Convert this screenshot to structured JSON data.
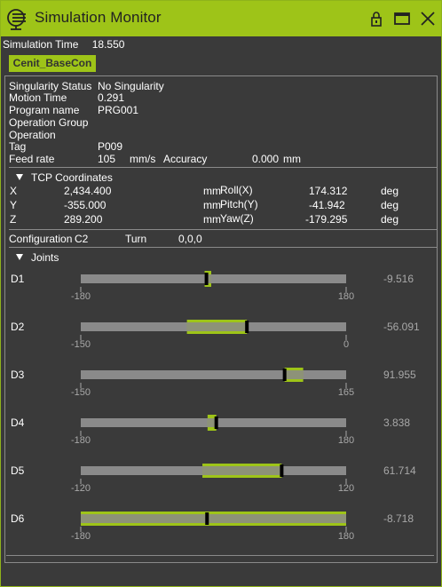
{
  "window": {
    "title": "Simulation Monitor"
  },
  "sim": {
    "time_label": "Simulation Time",
    "time_value": "18.550"
  },
  "tab": {
    "label": "Cenit_BaseCon"
  },
  "status": {
    "rows": [
      {
        "label": "Singularity Status",
        "value": "No Singularity"
      },
      {
        "label": "Motion Time",
        "value": "0.291"
      },
      {
        "label": "Program name",
        "value": "PRG001"
      },
      {
        "label": "Operation Group",
        "value": ""
      },
      {
        "label": "Operation",
        "value": ""
      },
      {
        "label": "Tag",
        "value": "P009"
      }
    ],
    "feed_label": "Feed rate",
    "feed_value": "105",
    "feed_unit": "mm/s",
    "accuracy_label": "Accuracy",
    "accuracy_value": "0.000",
    "accuracy_unit": "mm"
  },
  "tcp": {
    "header": "TCP Coordinates",
    "rows": [
      {
        "axis": "X",
        "value": "2,434.400",
        "unit": "mm",
        "rot_label": "Roll(X)",
        "rot_value": "174.312",
        "rot_unit": "deg"
      },
      {
        "axis": "Y",
        "value": "-355.000",
        "unit": "mm",
        "rot_label": "Pitch(Y)",
        "rot_value": "-41.942",
        "rot_unit": "deg"
      },
      {
        "axis": "Z",
        "value": "289.200",
        "unit": "mm",
        "rot_label": "Yaw(Z)",
        "rot_value": "-179.295",
        "rot_unit": "deg"
      }
    ]
  },
  "config": {
    "label": "Configuration",
    "value": "C2",
    "turn_label": "Turn",
    "turn_value": "0,0,0"
  },
  "joints": {
    "header": "Joints",
    "items": [
      {
        "name": "D1",
        "min": -180,
        "max": 180,
        "min_label": "-180",
        "max_label": "180",
        "value": -9.516,
        "value_label": "-9.516",
        "hl_from": -12,
        "hl_to": -3,
        "band": "narrow"
      },
      {
        "name": "D2",
        "min": -150,
        "max": 0,
        "min_label": "-150",
        "max_label": "0",
        "value": -56.091,
        "value_label": "-56.091",
        "hl_from": -90,
        "hl_to": -56.091,
        "band": "wide"
      },
      {
        "name": "D3",
        "min": -150,
        "max": 165,
        "min_label": "-150",
        "max_label": "165",
        "value": 91.955,
        "value_label": "91.955",
        "hl_from": 91.955,
        "hl_to": 114,
        "band": "wide"
      },
      {
        "name": "D4",
        "min": -180,
        "max": 180,
        "min_label": "-180",
        "max_label": "180",
        "value": 3.838,
        "value_label": "3.838",
        "hl_from": -8,
        "hl_to": 3.838,
        "band": "narrow"
      },
      {
        "name": "D5",
        "min": -120,
        "max": 120,
        "min_label": "-120",
        "max_label": "120",
        "value": 61.714,
        "value_label": "61.714",
        "hl_from": -10,
        "hl_to": 61.714,
        "band": "wide"
      },
      {
        "name": "D6",
        "min": -180,
        "max": 180,
        "min_label": "-180",
        "max_label": "180",
        "value": -8.718,
        "value_label": "-8.718",
        "hl_from": -180,
        "hl_to": 180,
        "band": "wide"
      }
    ]
  },
  "colors": {
    "accent": "#9ec418",
    "track": "#8a8a8a",
    "background": "#3a3a3a",
    "value_text": "#a8a8a8"
  }
}
